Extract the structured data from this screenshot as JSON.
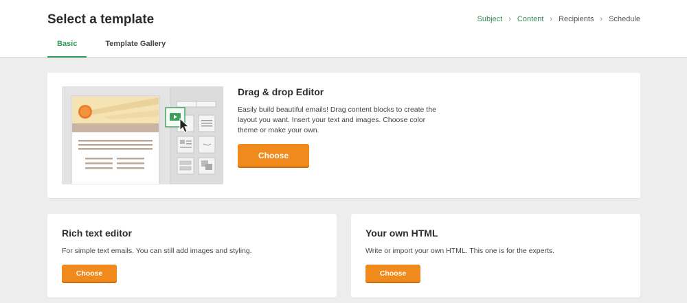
{
  "header": {
    "title": "Select a template",
    "breadcrumb": [
      {
        "label": "Subject",
        "done": true
      },
      {
        "label": "Content",
        "done": true
      },
      {
        "label": "Recipients",
        "done": false
      },
      {
        "label": "Schedule",
        "done": false
      }
    ],
    "tabs": [
      {
        "label": "Basic",
        "active": true
      },
      {
        "label": "Template Gallery",
        "active": false
      }
    ]
  },
  "drag_drop": {
    "title": "Drag & drop Editor",
    "description": "Easily build beautiful emails! Drag content blocks to create the layout you want. Insert your text and images. Choose color theme or make your own.",
    "button": "Choose"
  },
  "rich_text": {
    "title": "Rich text editor",
    "description": "For simple text emails. You can still add images and styling.",
    "button": "Choose"
  },
  "own_html": {
    "title": "Your own HTML",
    "description": "Write or import your own HTML. This one is for the experts.",
    "button": "Choose"
  },
  "colors": {
    "accent_green": "#2e9959",
    "button_orange": "#f18a1c"
  }
}
